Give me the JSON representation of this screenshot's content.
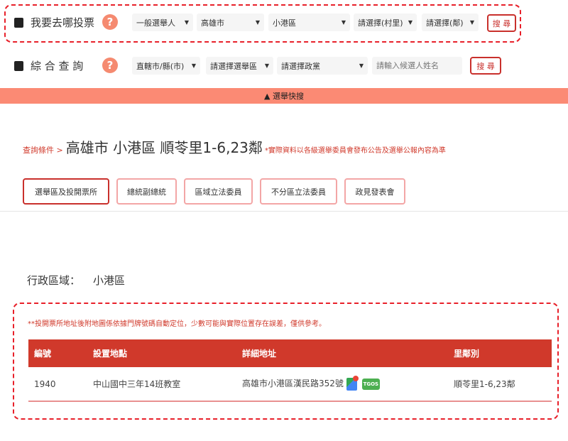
{
  "panel1": {
    "title": "我要去哪投票",
    "help": "?",
    "selects": [
      "一般選舉人",
      "高雄市",
      "小港區",
      "請選擇(村里)",
      "請選擇(鄰)"
    ],
    "search": "搜 尋"
  },
  "panel2": {
    "title": "綜 合 查 詢",
    "help": "?",
    "selects": [
      "直轄市/縣(市)",
      "請選擇選舉區",
      "請選擇政黨"
    ],
    "placeholder": "請輸入候選人姓名",
    "search": "搜 尋"
  },
  "quick_bar": "▲ 選舉快搜",
  "breadcrumb": {
    "prefix": "查詢條件 >",
    "title": "高雄市 小港區 順苓里1-6,23鄰",
    "note": "*實際資料以各級選舉委員會發布公告及選舉公報內容為準"
  },
  "tabs": [
    "選舉區及投開票所",
    "總統副總統",
    "區域立法委員",
    "不分區立法委員",
    "政見發表會"
  ],
  "region": {
    "label": "行政區域：",
    "value": "小港區"
  },
  "notice": "**投開票所地址後附地圖係依據門牌號碼自動定位，少數可能與實際位置存在誤差，僅供參考。",
  "table": {
    "headers": [
      "編號",
      "設置地點",
      "詳細地址",
      "里鄰別"
    ],
    "rows": [
      [
        "1940",
        "中山國中三年14班教室",
        "高雄市小港區漢民路352號",
        "順苓里1-6,23鄰"
      ]
    ],
    "tgos": "TGOS"
  },
  "colors": {
    "accent": "#d0392b",
    "bar": "#fb8a74"
  }
}
